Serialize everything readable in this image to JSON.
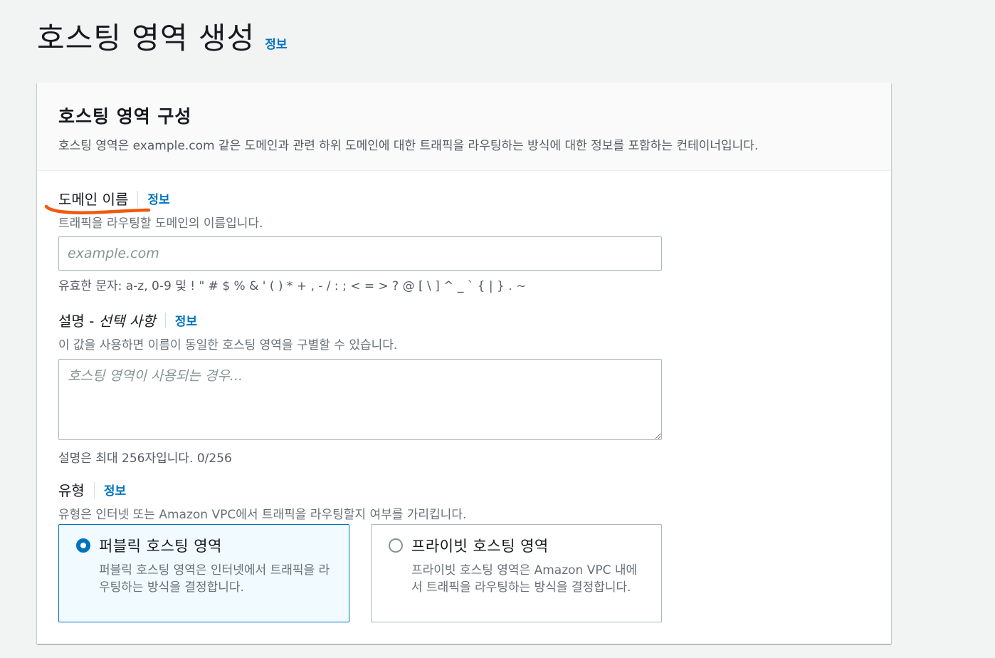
{
  "header": {
    "title": "호스팅 영역 생성",
    "info": "정보"
  },
  "panel": {
    "title": "호스팅 영역 구성",
    "description": "호스팅 영역은 example.com 같은 도메인과 관련 하위 도메인에 대한 트래픽을 라우팅하는 방식에 대한 정보를 포함하는 컨테이너입니다."
  },
  "domain": {
    "label": "도메인 이름",
    "info": "정보",
    "description": "트래픽을 라우팅할 도메인의 이름입니다.",
    "placeholder": "example.com",
    "value": "",
    "constraint": "유효한 문자: a-z, 0-9 및 ! \" # $ % & ' ( ) * + , - / : ; < = > ? @ [ \\ ] ^ _ ` { | } . ~",
    "annotation_color": "#f05a0f"
  },
  "description_field": {
    "label": "설명 - ",
    "label_optional": "선택 사항",
    "info": "정보",
    "description": "이 값을 사용하면 이름이 동일한 호스팅 영역을 구별할 수 있습니다.",
    "placeholder": "호스팅 영역이 사용되는 경우...",
    "value": "",
    "constraint": "설명은 최대 256자입니다. 0/256"
  },
  "type": {
    "label": "유형",
    "info": "정보",
    "description": "유형은 인터넷 또는 Amazon VPC에서 트래픽을 라우팅할지 여부를 가리킵니다.",
    "options": [
      {
        "title": "퍼블릭 호스팅 영역",
        "description": "퍼블릭 호스팅 영역은 인터넷에서 트래픽을 라우팅하는 방식을 결정합니다.",
        "selected": true
      },
      {
        "title": "프라이빗 호스팅 영역",
        "description": "프라이빗 호스팅 영역은 Amazon VPC 내에서 트래픽을 라우팅하는 방식을 결정합니다.",
        "selected": false
      }
    ]
  },
  "colors": {
    "accent": "#0073bb",
    "background": "#f2f3f3",
    "selected_tile_bg": "#f1faff"
  }
}
